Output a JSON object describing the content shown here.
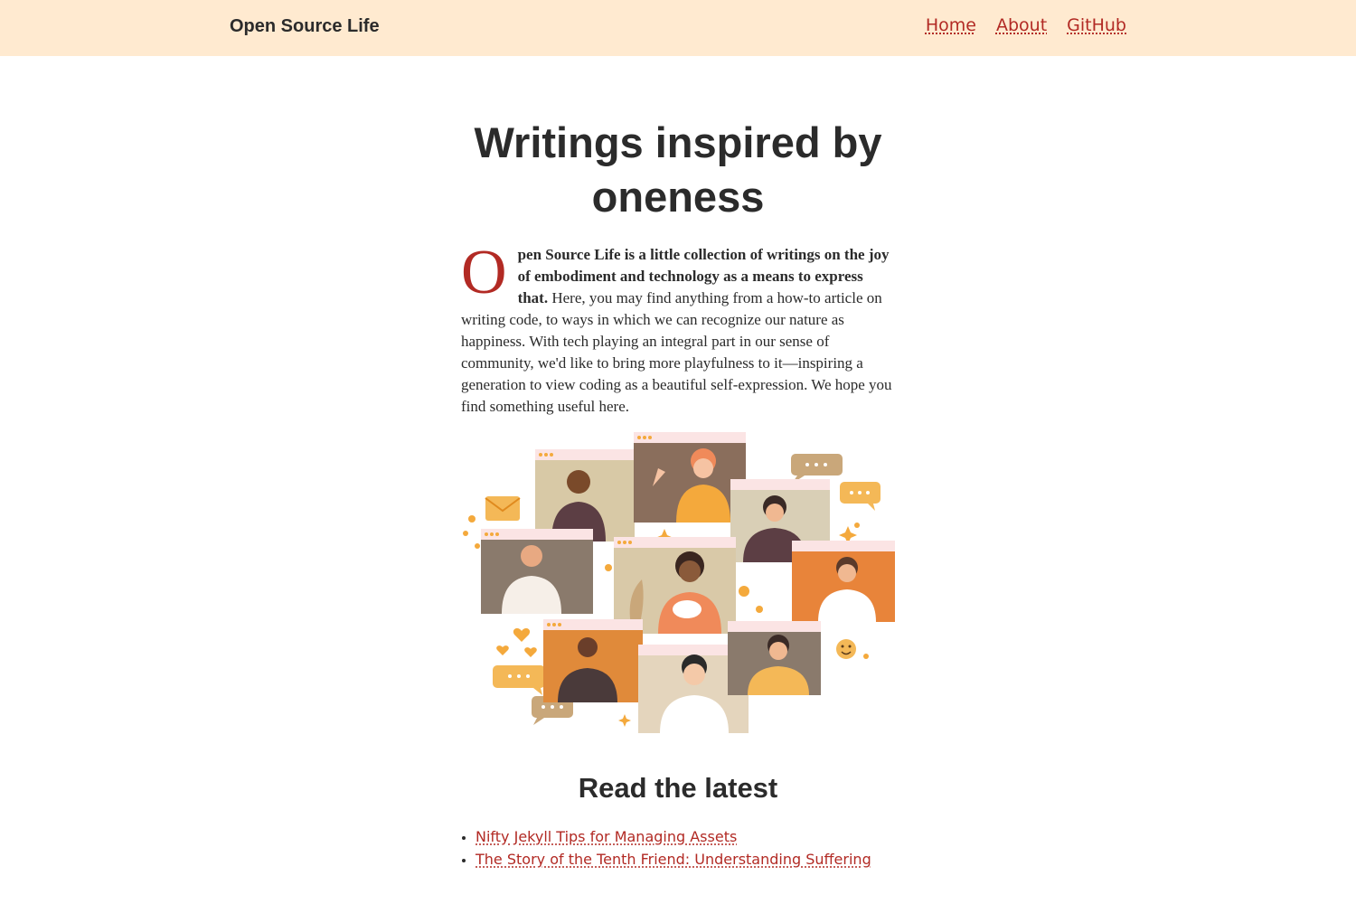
{
  "header": {
    "site_title": "Open Source Life",
    "nav": [
      {
        "label": "Home"
      },
      {
        "label": "About"
      },
      {
        "label": "GitHub"
      }
    ]
  },
  "hero": {
    "title": "Writings inspired by oneness"
  },
  "intro": {
    "dropcap": "O",
    "bold_text": "pen Source Life is a little collection of writings on the joy of embodiment and technology as a means to express that.",
    "body_text": " Here, you may find anything from a how-to article on writing code, to ways in which we can recognize our nature as happiness. With tech playing an integral part in our sense of community, we'd like to bring more playfulness to it—inspiring a generation to view coding as a beautiful self-expression. We hope you find something useful here."
  },
  "illustration": {
    "icon": "video-call-community-illustration"
  },
  "latest": {
    "title": "Read the latest",
    "posts": [
      {
        "title": "Nifty Jekyll Tips for Managing Assets"
      },
      {
        "title": "The Story of the Tenth Friend: Understanding Suffering"
      }
    ]
  },
  "colors": {
    "header_bg": "#ffead0",
    "accent": "#b22a24",
    "text": "#2b2b2b"
  }
}
